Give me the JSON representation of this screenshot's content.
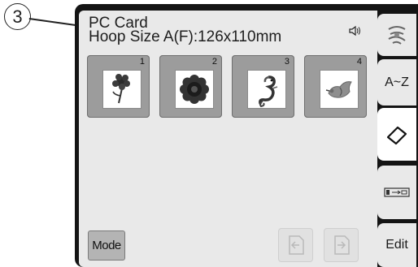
{
  "callout": {
    "number": "3"
  },
  "header": {
    "title": "PC Card",
    "hoop_size": "Hoop Size A(F):126x110mm"
  },
  "tiles": [
    {
      "number": "1",
      "icon": "flower-stem-icon"
    },
    {
      "number": "2",
      "icon": "round-flower-icon"
    },
    {
      "number": "3",
      "icon": "seahorse-icon"
    },
    {
      "number": "4",
      "icon": "bird-icon"
    }
  ],
  "controls": {
    "mode_label": "Mode"
  },
  "side_tabs": [
    {
      "icon": "embroidery-pattern-icon"
    },
    {
      "label": "A~Z"
    },
    {
      "icon": "eraser-icon"
    },
    {
      "icon": "card-slot-icon"
    },
    {
      "label": "Edit"
    }
  ]
}
